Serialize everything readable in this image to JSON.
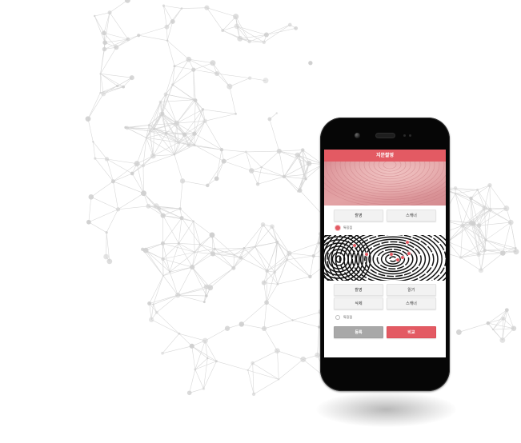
{
  "app": {
    "title": "지문촬영"
  },
  "section_top": {
    "capture_label": "촬영",
    "scanner_label": "스캐너",
    "feature_label": "특징점",
    "feature_selected": true
  },
  "section_bottom": {
    "capture_label": "촬영",
    "read_label": "읽기",
    "delete_label": "삭제",
    "scanner_label": "스캐너",
    "feature_label": "특징점",
    "feature_selected": false
  },
  "actions": {
    "register_label": "등록",
    "compare_label": "비교"
  },
  "colors": {
    "accent": "#e35a63",
    "gray_button": "#a8a8a8",
    "network": "#d4d4d4"
  }
}
